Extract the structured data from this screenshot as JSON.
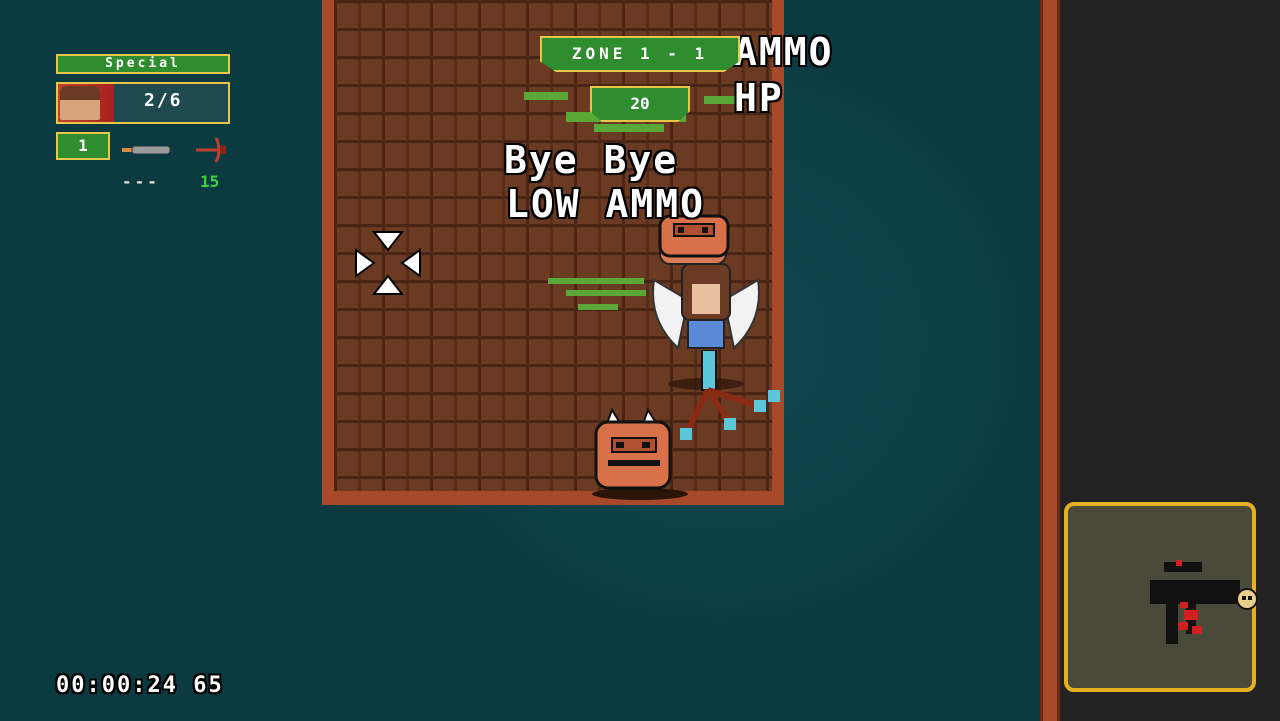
{
  "hud": {
    "special_label": "Special",
    "hp_text": "2/6",
    "hp_fraction": 0.33,
    "weapon_slot": "1",
    "primary_ammo": "---",
    "secondary_ammo": "15",
    "timer": "00:00:24 65"
  },
  "zone": {
    "label": "ZONE 1 - 1",
    "kill_count": "20"
  },
  "floating_text": {
    "line1": "AMMO",
    "line2": "HP",
    "line3": "Bye Bye",
    "line4": "LOW AMMO"
  },
  "icons": {
    "portrait": "player-portrait",
    "weapon_primary": "knife-icon",
    "weapon_secondary": "crossbow-icon",
    "crosshair": "crosshair-icon",
    "minimap_boss": "skull-icon"
  },
  "colors": {
    "hud_green": "#2f8c2f",
    "hud_border": "#e8c64a",
    "hp_red": "#c24030",
    "ammo_green": "#3ed43e",
    "brick": "#6b3a22",
    "wall_trim": "#a84a2a",
    "background": "#0b3a40",
    "minimap_border": "#e8b020"
  }
}
